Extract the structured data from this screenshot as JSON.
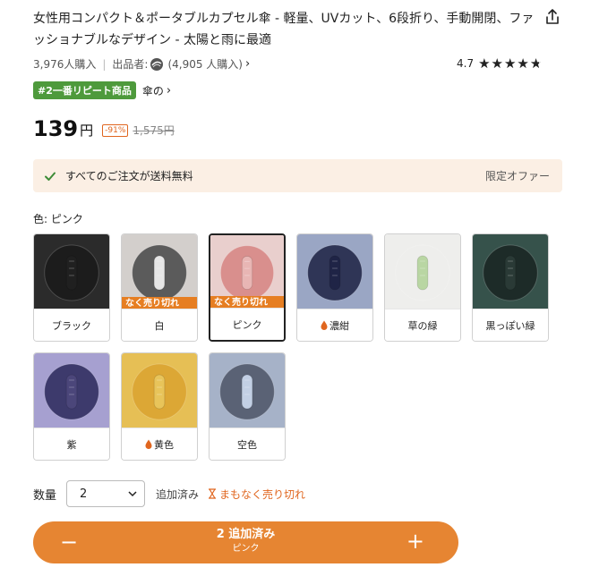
{
  "product": {
    "title": "女性用コンパクト＆ポータブルカプセル傘 - 軽量、UVカット、6段折り、手動開閉、ファッショナブルなデザイン - 太陽と雨に最適",
    "purchases": "3,976人購入",
    "seller_label": "出品者:",
    "seller_purchases": "(4,905 人購入)",
    "rating_value": "4.7",
    "rating_fraction": 0.94,
    "rank_badge": "#2一番リピート商品",
    "category": "傘の"
  },
  "price": {
    "current": "139",
    "unit": "円",
    "discount": "-91%",
    "original": "1,575円"
  },
  "shipping": {
    "text": "すべてのご注文が送料無料",
    "offer": "限定オファー"
  },
  "color": {
    "label": "色: ピンク",
    "options": [
      {
        "name": "ブラック",
        "bg": "#2b2b2b",
        "plate": "#1c1c1c",
        "umbrella": "#202020"
      },
      {
        "name": "白",
        "bg": "#d3cfcc",
        "plate": "#5b5b5b",
        "umbrella": "#e6e6e6",
        "soldout": "なく売り切れ"
      },
      {
        "name": "ピンク",
        "bg": "#e9cfcd",
        "plate": "#d98f8d",
        "umbrella": "#e8b6b4",
        "soldout": "なく売り切れ",
        "selected": true
      },
      {
        "name": "濃紺",
        "bg": "#9aa6c4",
        "plate": "#2f3556",
        "umbrella": "#1f2446",
        "drop": true
      },
      {
        "name": "草の緑",
        "bg": "#eeeeec",
        "plate": "#eeeeec",
        "umbrella": "#b9d6a3"
      },
      {
        "name": "黒っぽい緑",
        "bg": "#36524b",
        "plate": "#1d2b28",
        "umbrella": "#2a3a36"
      },
      {
        "name": "紫",
        "bg": "#a6a0d0",
        "plate": "#3d3a6c",
        "umbrella": "#4b467a"
      },
      {
        "name": "黄色",
        "bg": "#e6bf55",
        "plate": "#dca735",
        "umbrella": "#e8c45a",
        "drop": true
      },
      {
        "name": "空色",
        "bg": "#a6b2c8",
        "plate": "#5a6275",
        "umbrella": "#c2cfe4"
      }
    ]
  },
  "quantity": {
    "label": "数量",
    "value": "2",
    "added": "追加済み",
    "selling_out": "まもなく売り切れ"
  },
  "cart_button": {
    "main": "2 追加済み",
    "sub": "ピンク",
    "minus": "−",
    "plus": "+"
  },
  "colors": {
    "accent": "#e68532",
    "badge_green": "#4e9a3c",
    "shipping_bg": "#fbefe4",
    "soldout_orange": "#e67e22"
  }
}
